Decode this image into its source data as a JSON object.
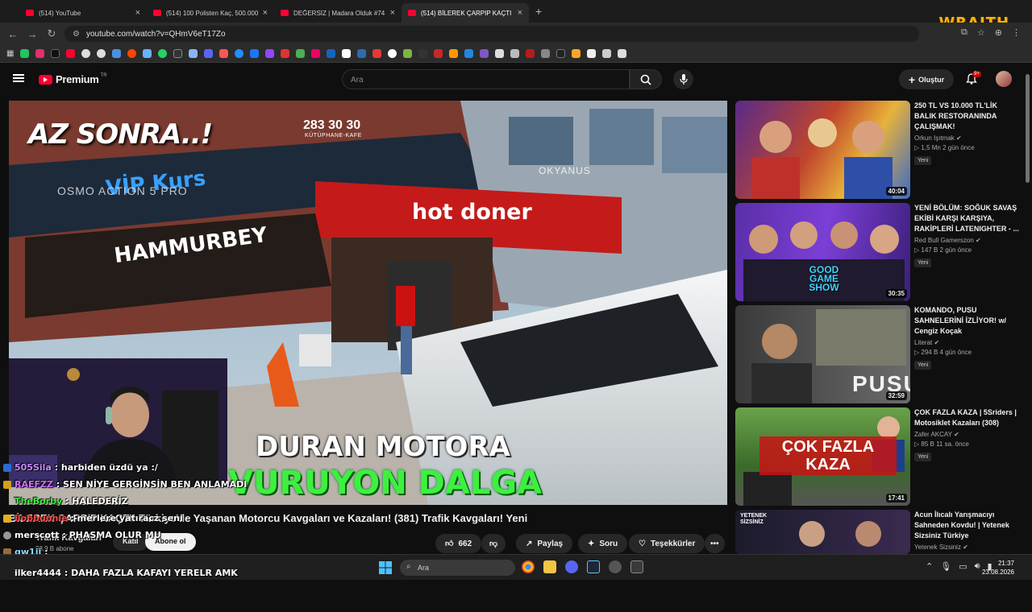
{
  "browser": {
    "tabs": [
      {
        "title": "(514) YouTube"
      },
      {
        "title": "(514) 100 Polisten Kaç, 500.000"
      },
      {
        "title": "DEĞERSİZ | Madara Olduk #74"
      },
      {
        "title": "(514) BİLEREK ÇARPIP KAÇTI Tü"
      }
    ],
    "url": "youtube.com/watch?v=QHmV6eT17Zo"
  },
  "overlay": {
    "brand": "WRAITH"
  },
  "youtube": {
    "logo_text": "Premium",
    "logo_region": "TR",
    "search_placeholder": "Ara",
    "create_label": "Oluştur",
    "notif_count": "9+"
  },
  "video": {
    "overlay_top": "AZ SONRA..!",
    "phone": "283 30 30",
    "phone_sub": "KÜTÜPHANE-KAFE",
    "camera_mark": "OSMO ACTION 5 PRO",
    "sign_hotdoner": "hot doner",
    "sign_hammur": "HAMMURBEY",
    "sign_vip": "VİP Kurs",
    "sign_okyanus": "OKYANUS",
    "caption1": "DURAN MOTORA",
    "caption2": "VURUYON DALGA",
    "title": "BİLEREK ÇARPIP KAÇTI! Türkiye'de Yaşanan Motorcu Kavgaları ve Kazaları! (381) Trafik Kavgaları! Yeni",
    "channel": "Trafik Kavgaları",
    "subscribers": "98,9 B abone",
    "join_label": "Katıl",
    "subscribe_label": "Abone ol",
    "likes": "662",
    "share_label": "Paylaş",
    "ask_label": "Soru",
    "thanks_label": "Teşekkürler"
  },
  "recommendations": [
    {
      "title": "250 TL VS 10.000 TL'LİK BALIK RESTORANINDA ÇALIŞMAK!",
      "channel": "Orkun Işıtmak",
      "meta": "1,5 Mn  2 gün önce",
      "badge": "Yeni",
      "duration": "40:04"
    },
    {
      "title": "YENİ BÖLÜM: SOĞUK SAVAŞ EKİBİ KARŞI KARŞIYA, RAKİPLERİ LATENIGHTER - ...",
      "channel": "Red Bull Gamerszon",
      "meta": "147 B  2 gün önce",
      "badge": "Yeni",
      "duration": "30:35",
      "thumb_text": "GOOD GAME SHOW"
    },
    {
      "title": "KOMANDO, PUSU SAHNELERİNİ İZLİYOR! w/ Cengiz Koçak",
      "channel": "Literat",
      "meta": "294 B  4 gün önce",
      "badge": "Yeni",
      "duration": "32:59",
      "thumb_text": "PUSU"
    },
    {
      "title": "ÇOK FAZLA KAZA | 5Sriders | Motosiklet Kazaları (308)",
      "channel": "Zafer AKCAY",
      "meta": "85 B  11 sa. önce",
      "badge": "Yeni",
      "duration": "17:41",
      "thumb_text": "ÇOK FAZLA KAZA"
    },
    {
      "title": "Acun İlıcalı Yarışmacıyı Sahneden Kovdu! | Yetenek Sizsiniz Türkiye",
      "channel": "Yetenek Sizsiniz",
      "meta": "",
      "badge": "",
      "duration": "",
      "thumb_text": "YETENEK SİZSİNİZ"
    }
  ],
  "chat": [
    {
      "user": "505Sila",
      "text": ": harbiden üzdü ya :/",
      "color": "#c98bff"
    },
    {
      "user": "RAEFZZ",
      "text": ": SEN NİYE GERGİNSİN BEN ANLAMADI",
      "color": "#d36bff"
    },
    {
      "user": "TheBorby",
      "text": ": HALEDERİZ",
      "color": "#3ef03e"
    },
    {
      "user": "llobbunnie",
      "text": ": merlere yatıracz seni",
      "color": "#ff4a4a"
    },
    {
      "user": "merscott",
      "text": ": PHASMA OLUR MU",
      "color": "#ffffff"
    },
    {
      "user": "qw1ii",
      "text": ":",
      "color": "#8de0ff"
    }
  ],
  "chat_last": "ilker4444 : DAHA FAZLA KAFAYI YERELR AMK",
  "taskbar": {
    "search": "Ara",
    "time": "21:37",
    "date": "23.08.2026"
  }
}
